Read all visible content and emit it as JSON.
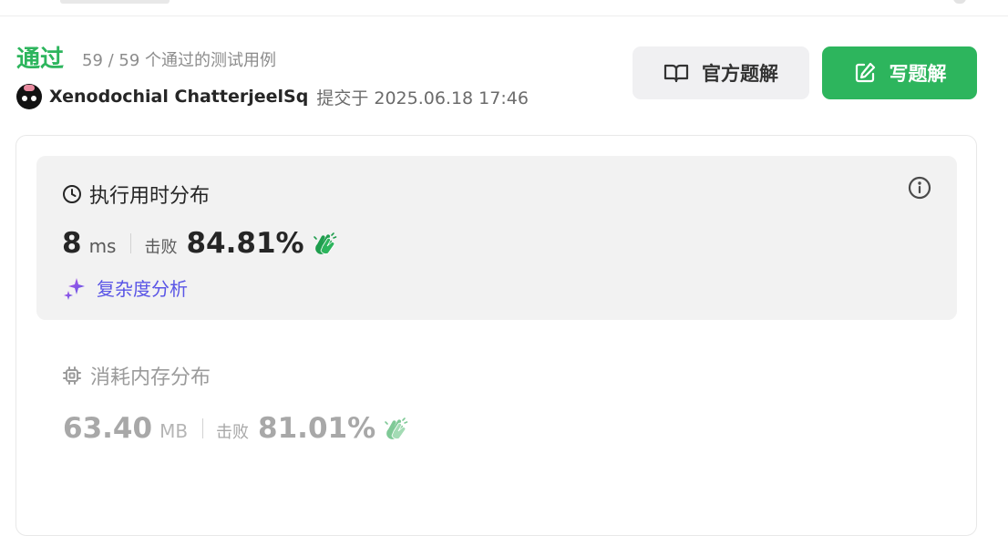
{
  "result": {
    "status": "通过",
    "test_summary": "59 / 59 个通过的测试用例",
    "author": "Xenodochial ChatterjeelSq",
    "submitted": "提交于 2025.06.18 17:46"
  },
  "actions": {
    "official_solution": "官方题解",
    "write_solution": "写题解"
  },
  "runtime": {
    "title": "执行用时分布",
    "value": "8",
    "unit": "ms",
    "beat_label": "击败",
    "beat_percent": "84.81%",
    "complexity_link": "复杂度分析"
  },
  "memory": {
    "title": "消耗内存分布",
    "value": "63.40",
    "unit": "MB",
    "beat_label": "击败",
    "beat_percent": "81.01%"
  },
  "colors": {
    "accepted_green": "#2db55d",
    "complexity_purple": "#5a55e6"
  },
  "icons": {
    "official_solution": "book-open-icon",
    "write_solution": "edit-icon",
    "runtime": "clock-icon",
    "info": "info-circle-icon",
    "complexity": "sparkles-icon",
    "memory": "chip-icon",
    "beat": "clapping-hands-icon"
  }
}
